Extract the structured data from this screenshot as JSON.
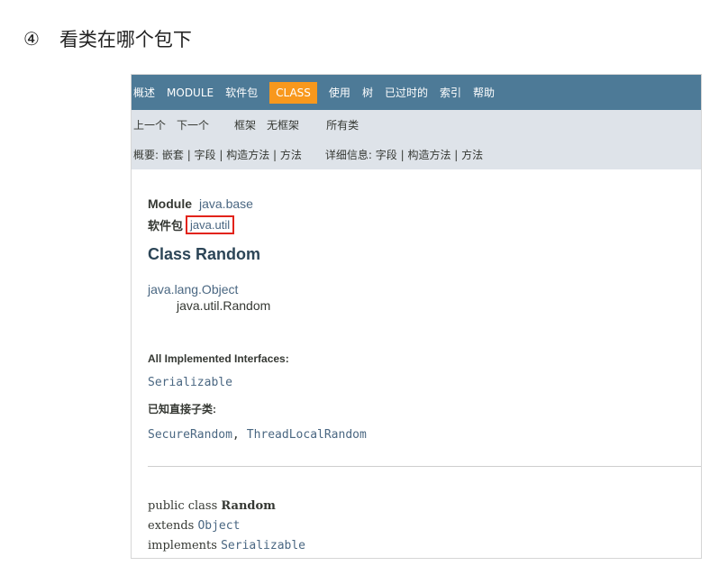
{
  "heading": {
    "number": "④",
    "text": "看类在哪个包下"
  },
  "topnav": {
    "items": [
      "概述",
      "MODULE",
      "软件包",
      "CLASS",
      "使用",
      "树",
      "已过时的",
      "索引",
      "帮助"
    ],
    "active": "CLASS"
  },
  "subnav": {
    "prev": "上一个",
    "next": "下一个",
    "frames": "框架",
    "no_frames": "无框架",
    "all_classes": "所有类",
    "summary_label": "概要:",
    "summary_items": "嵌套 | 字段 | 构造方法 | 方法",
    "detail_label": "详细信息:",
    "detail_items": "字段 | 构造方法 | 方法"
  },
  "content": {
    "module_label": "Module",
    "module_value": "java.base",
    "package_label": "软件包",
    "package_value": "java.util",
    "class_title": "Class Random",
    "inherit_parent": "java.lang.Object",
    "inherit_child": "java.util.Random",
    "implemented_title": "All Implemented Interfaces:",
    "implemented_value": "Serializable",
    "subclasses_title": "已知直接子类:",
    "subclass_1": "SecureRandom",
    "subclass_sep": ",",
    "subclass_2": "ThreadLocalRandom",
    "decl_line1_kw": "public class ",
    "decl_line1_name": "Random",
    "decl_line2_kw": "extends ",
    "decl_line2_val": "Object",
    "decl_line3_kw": "implements ",
    "decl_line3_val": "Serializable"
  },
  "colors": {
    "nav_bg": "#4d7a97",
    "active_tab": "#f8981d",
    "subnav_bg": "#dee3e9",
    "highlight_box": "#e2231a",
    "link": "#4a6782"
  }
}
